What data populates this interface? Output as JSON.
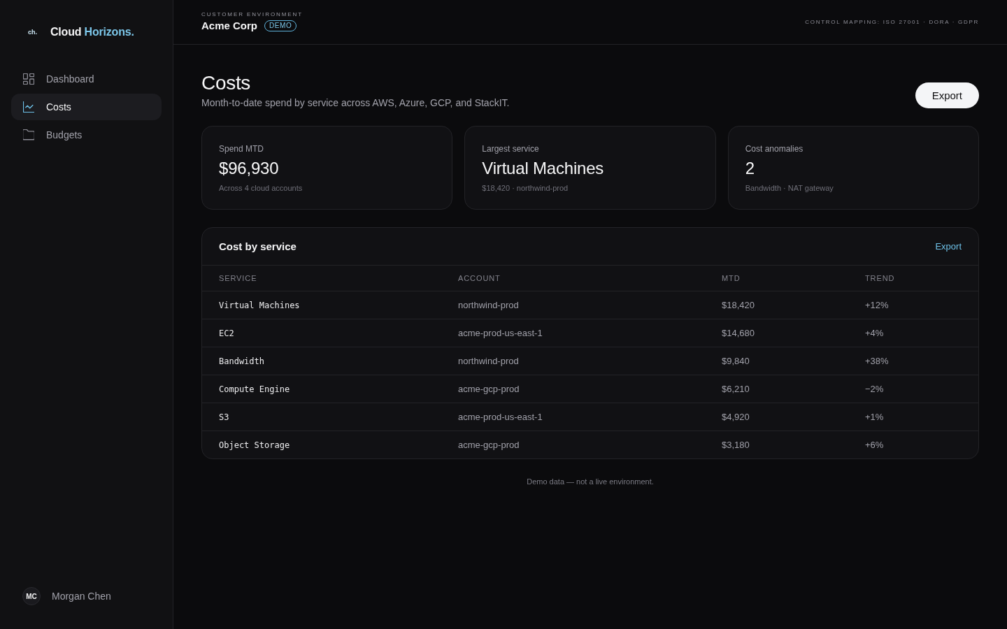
{
  "sidebar": {
    "brand": {
      "mark": "ch.",
      "name": "Cloud",
      "accent": "Horizons."
    },
    "nav": [
      {
        "label": "Dashboard",
        "selected": false
      },
      {
        "label": "Costs",
        "selected": true
      },
      {
        "label": "Budgets",
        "selected": false
      }
    ],
    "user": {
      "initials": "MC",
      "name": "Morgan Chen"
    }
  },
  "header": {
    "eyebrow": "CUSTOMER ENVIRONMENT",
    "customer": "Acme Corp",
    "badge": "DEMO",
    "compliance": "CONTROL MAPPING: ISO 27001 · DORA · GDPR"
  },
  "page": {
    "title": "Costs",
    "subtitle": "Month-to-date spend by service across AWS, Azure, GCP, and StackIT.",
    "action": "Export"
  },
  "stats": [
    {
      "label": "Spend MTD",
      "value": "$96,930",
      "note": "Across 4 cloud accounts"
    },
    {
      "label": "Largest service",
      "value": "Virtual Machines",
      "note": "$18,420 · northwind-prod"
    },
    {
      "label": "Cost anomalies",
      "value": "2",
      "note": "Bandwidth · NAT gateway"
    }
  ],
  "table": {
    "title": "Cost by service",
    "action": "Export",
    "columns": [
      "SERVICE",
      "ACCOUNT",
      "MTD",
      "TREND"
    ],
    "rows": [
      [
        "Virtual Machines",
        "northwind-prod",
        "$18,420",
        "+12%"
      ],
      [
        "EC2",
        "acme-prod-us-east-1",
        "$14,680",
        "+4%"
      ],
      [
        "Bandwidth",
        "northwind-prod",
        "$9,840",
        "+38%"
      ],
      [
        "Compute Engine",
        "acme-gcp-prod",
        "$6,210",
        "−2%"
      ],
      [
        "S3",
        "acme-prod-us-east-1",
        "$4,920",
        "+1%"
      ],
      [
        "Object Storage",
        "acme-gcp-prod",
        "$3,180",
        "+6%"
      ]
    ]
  },
  "footer": "Demo data — not a live environment."
}
